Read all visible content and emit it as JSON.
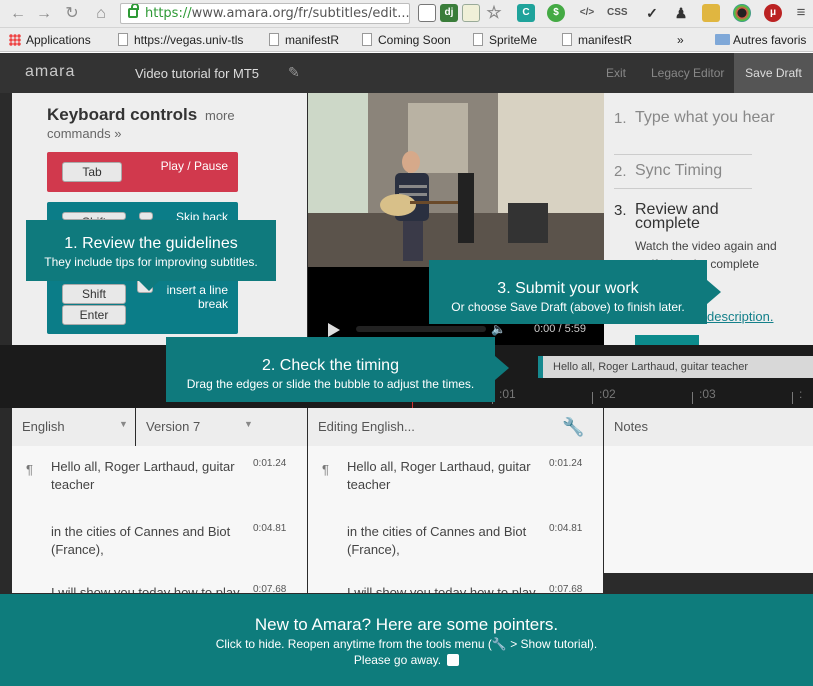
{
  "browser": {
    "url_scheme": "https://",
    "url_rest": "www.amara.org/fr/subtitles/edit...",
    "bookmarks": [
      "Applications",
      "https://vegas.univ-tls",
      "manifestR",
      "Coming Soon",
      "SpriteMe",
      "manifestR"
    ],
    "overflow": "»",
    "other_bookmarks": "Autres favoris"
  },
  "app": {
    "logo": "amara",
    "video_title": "Video tutorial for MT5",
    "exit": "Exit",
    "legacy_editor": "Legacy Editor",
    "save_draft": "Save Draft"
  },
  "keyboard": {
    "title": "Keyboard controls",
    "more": "more",
    "commands": "commands »",
    "tab_key": "Tab",
    "play_pause": "Play / Pause",
    "shift_key": "Shift",
    "skip_back": "Skip back",
    "insert_line": "insert a line",
    "break": "break",
    "shift_key2": "Shift",
    "enter_key": "Enter"
  },
  "player": {
    "time": "0:00 / 5:59"
  },
  "steps": [
    {
      "num": "1.",
      "text": "Type what you hear"
    },
    {
      "num": "2.",
      "text": "Sync Timing"
    },
    {
      "num": "3.",
      "text": "Review and complete"
    }
  ],
  "step_body": "Watch the video again and verify that the complete",
  "step_link": "description.",
  "timeline": {
    "bubble": "Hello all, Roger Larthaud, guitar teacher",
    "ticks": [
      ":01",
      ":02",
      ":03"
    ]
  },
  "columns": {
    "language": "English",
    "version": "Version 7",
    "editing": "Editing English...",
    "notes": "Notes"
  },
  "subtitles": [
    {
      "text": "Hello all, Roger Larthaud, guitar teacher",
      "time": "0:01.24"
    },
    {
      "text": "in the cities of Cannes and Biot (France),",
      "time": "0:04.81"
    },
    {
      "text": "I will show you today how to play",
      "time": "0:07.68"
    }
  ],
  "callouts": {
    "c1_title": "1. Review the guidelines",
    "c1_sub": "They include tips for improving subtitles.",
    "c2_title": "2. Check the timing",
    "c2_sub": "Drag the edges or slide the bubble to adjust the times.",
    "c3_title": "3. Submit your work",
    "c3_sub": "Or choose Save Draft (above) to finish later."
  },
  "footer": {
    "title": "New to Amara? Here are some pointers.",
    "sub_a": "Click to hide. Reopen anytime from the tools menu (",
    "sub_b": " > Show tutorial).",
    "go_away": "Please go away."
  }
}
